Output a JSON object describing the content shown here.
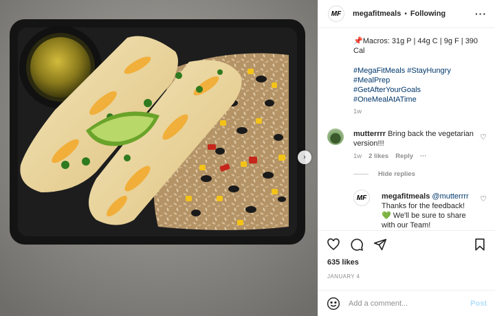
{
  "header": {
    "username": "megafitmeals",
    "separator": "•",
    "follow_status": "Following",
    "logo_text": "MF",
    "more_label": "···"
  },
  "caption": {
    "macros": "📌Macros: 31g P | 44g C | 9g F | 390 Cal",
    "hashtags": [
      "#MegaFitMeals #StayHungry",
      "#MealPrep",
      "#GetAfterYourGoals",
      "#OneMealAtATime"
    ],
    "time": "1w"
  },
  "comment": {
    "username": "mutterrrr",
    "text": "Bring back the vegetarian version!!!",
    "time": "1w",
    "likes": "2 likes",
    "reply": "Reply",
    "options": "···"
  },
  "hide_replies": "Hide replies",
  "reply_comment": {
    "username": "megafitmeals",
    "mention": "@mutterrrr",
    "line1": "Thanks for the feedback!",
    "heart": "💚",
    "line2": " We'll be sure to share with our Team!"
  },
  "likes": "635 likes",
  "date": "JANUARY 4",
  "add_comment": {
    "placeholder": "Add a comment...",
    "post_label": "Post"
  },
  "icons": [
    "heart-icon",
    "comment-icon",
    "share-icon",
    "bookmark-icon",
    "emoji-icon",
    "chevron-right-icon",
    "more-icon"
  ],
  "colors": {
    "link": "#00376b",
    "muted": "#8e8e8e",
    "post_disabled": "#b2dffc"
  }
}
